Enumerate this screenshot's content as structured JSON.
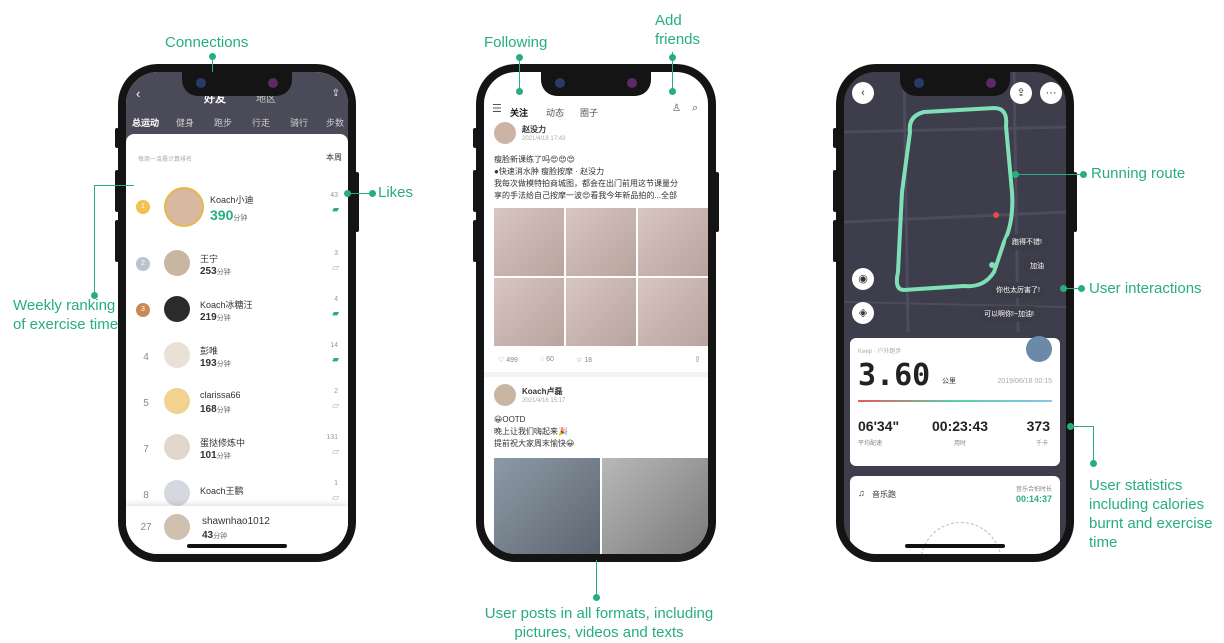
{
  "callouts": {
    "connections": "Connections",
    "likes": "Likes",
    "weekly_ranking": "Weekly ranking of exercise time",
    "following": "Following",
    "add_friends": "Add friends",
    "user_posts": "User posts in all formats, including pictures, videos and texts",
    "running_route": "Running route",
    "user_interactions": "User interactions",
    "user_statistics": "User statistics including calories burnt and exercise time"
  },
  "phone1": {
    "title": "好友",
    "title_alt": "地区",
    "tabs": [
      "总运动",
      "健身",
      "跑步",
      "行走",
      "骑行",
      "步数"
    ],
    "subtitle": "每周一凌晨计算排名",
    "period": "本周",
    "unit": "分钟",
    "rows": [
      {
        "rank": "1",
        "name": "Koach小迪",
        "minutes": "390",
        "likes": "43"
      },
      {
        "rank": "2",
        "name": "王宁",
        "minutes": "253",
        "likes": "3"
      },
      {
        "rank": "3",
        "name": "Koach冰糖汪",
        "minutes": "219",
        "likes": "4"
      },
      {
        "rank": "4",
        "name": "彭唯",
        "minutes": "193",
        "likes": "14"
      },
      {
        "rank": "5",
        "name": "clarissa66",
        "minutes": "168",
        "likes": "2"
      },
      {
        "rank": "7",
        "name": "蛋挞修炼中",
        "minutes": "101",
        "likes": "131"
      },
      {
        "rank": "8",
        "name": "Koach王鹏",
        "minutes": "",
        "likes": "1"
      },
      {
        "rank": "27",
        "name": "shawnhao1012",
        "minutes": "43",
        "likes": ""
      }
    ]
  },
  "phone2": {
    "tabs": [
      "关注",
      "动态",
      "圈子"
    ],
    "post1": {
      "user": "赵没力",
      "time": "2021/4/18 17:43",
      "line1": "瘦脸新课练了吗😍😍😍",
      "tags": "●快速消水肿 瘦脸按摩 · 赵没力",
      "line2": "我每次做模特拍商城图，都会在出门前用这节课量分",
      "line3": "享的手法给自己按摩一波😍看我今年新品拍的...全部",
      "likes": "499",
      "comments": "60",
      "stars": "18"
    },
    "post2": {
      "user": "Koach卢磊",
      "time": "2021/4/16 15:17",
      "line1": "😀OOTD",
      "line2": "晚上让我们嗨起来🎉",
      "line3": "提前祝大家周末愉快😀"
    }
  },
  "phone3": {
    "bubbles": [
      "跑得不错!",
      "加油",
      "你也太厉害了!",
      "可以啊你!~加油!"
    ],
    "card_label": "Keep · 户外跑步",
    "distance": "3.60",
    "distance_unit": "公里",
    "date": "2019/06/18 00:15",
    "pace": "06'34\"",
    "pace_label": "平均配速",
    "duration": "00:23:43",
    "duration_label": "用时",
    "calories": "373",
    "calories_label": "千卡",
    "music_label": "音乐跑",
    "music_time_label": "音乐合拍时长",
    "music_time": "00:14:37"
  }
}
